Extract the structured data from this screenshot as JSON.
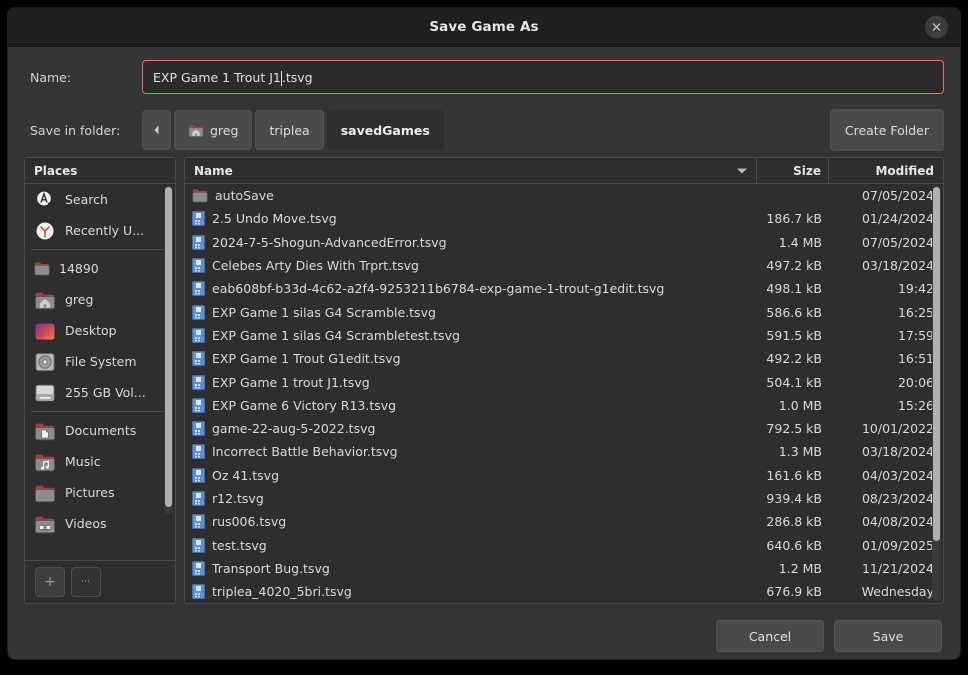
{
  "window": {
    "title": "Save Game As",
    "close_label": "✕"
  },
  "form": {
    "name_label": "Name:",
    "name_value_before_caret": "EXP Game 1 Trout J1",
    "name_value_after_caret": ".tsvg",
    "name_value_full": "EXP Game 1 Trout J1.tsvg",
    "name_placeholder": "",
    "folder_label": "Save in folder:",
    "create_folder_label": "Create Folder",
    "back_label": "◂"
  },
  "breadcrumbs": [
    {
      "label": "greg",
      "icon": "home-folder-icon",
      "current": false
    },
    {
      "label": "triplea",
      "icon": "",
      "current": false
    },
    {
      "label": "savedGames",
      "icon": "",
      "current": true
    }
  ],
  "places": {
    "header": "Places",
    "items": [
      {
        "label": "Search",
        "icon": "search-icon",
        "group": 0
      },
      {
        "label": "Recently U...",
        "icon": "clock-icon",
        "group": 0
      },
      {
        "label": "14890",
        "icon": "folder-icon",
        "group": 1
      },
      {
        "label": "greg",
        "icon": "home-folder-icon",
        "group": 1
      },
      {
        "label": "Desktop",
        "icon": "desktop-folder-icon",
        "group": 1
      },
      {
        "label": "File System",
        "icon": "disc-icon",
        "group": 1
      },
      {
        "label": "255 GB Vol...",
        "icon": "drive-icon",
        "group": 1
      },
      {
        "label": "Documents",
        "icon": "documents-folder-icon",
        "group": 2
      },
      {
        "label": "Music",
        "icon": "music-folder-icon",
        "group": 2
      },
      {
        "label": "Pictures",
        "icon": "pictures-folder-icon",
        "group": 2
      },
      {
        "label": "Videos",
        "icon": "videos-folder-icon",
        "group": 2
      }
    ],
    "add_button": "+",
    "more_button": "⋯"
  },
  "file_list": {
    "columns": {
      "name": "Name",
      "size": "Size",
      "modified": "Modified"
    },
    "sort_column": "Name",
    "sort_direction": "descending-arrow",
    "rows": [
      {
        "name": "autoSave",
        "size": "",
        "modified": "07/05/2024",
        "icon": "folder-icon"
      },
      {
        "name": "2.5 Undo Move.tsvg",
        "size": "186.7 kB",
        "modified": "01/24/2024",
        "icon": "file-icon"
      },
      {
        "name": "2024-7-5-Shogun-AdvancedError.tsvg",
        "size": "1.4 MB",
        "modified": "07/05/2024",
        "icon": "file-icon"
      },
      {
        "name": "Celebes Arty Dies With Trprt.tsvg",
        "size": "497.2 kB",
        "modified": "03/18/2024",
        "icon": "file-icon"
      },
      {
        "name": "eab608bf-b33d-4c62-a2f4-9253211b6784-exp-game-1-trout-g1edit.tsvg",
        "size": "498.1 kB",
        "modified": "19:42",
        "icon": "file-icon"
      },
      {
        "name": "EXP Game 1 silas G4 Scramble.tsvg",
        "size": "586.6 kB",
        "modified": "16:25",
        "icon": "file-icon"
      },
      {
        "name": "EXP Game 1 silas G4 Scrambletest.tsvg",
        "size": "591.5 kB",
        "modified": "17:59",
        "icon": "file-icon"
      },
      {
        "name": "EXP Game 1 Trout G1edit.tsvg",
        "size": "492.2 kB",
        "modified": "16:51",
        "icon": "file-icon"
      },
      {
        "name": "EXP Game 1 trout J1.tsvg",
        "size": "504.1 kB",
        "modified": "20:06",
        "icon": "file-icon"
      },
      {
        "name": "EXP Game 6 Victory R13.tsvg",
        "size": "1.0 MB",
        "modified": "15:26",
        "icon": "file-icon"
      },
      {
        "name": "game-22-aug-5-2022.tsvg",
        "size": "792.5 kB",
        "modified": "10/01/2022",
        "icon": "file-icon"
      },
      {
        "name": "Incorrect Battle Behavior.tsvg",
        "size": "1.3 MB",
        "modified": "03/18/2024",
        "icon": "file-icon"
      },
      {
        "name": "Oz 41.tsvg",
        "size": "161.6 kB",
        "modified": "04/03/2024",
        "icon": "file-icon"
      },
      {
        "name": "r12.tsvg",
        "size": "939.4 kB",
        "modified": "08/23/2024",
        "icon": "file-icon"
      },
      {
        "name": "rus006.tsvg",
        "size": "286.8 kB",
        "modified": "04/08/2024",
        "icon": "file-icon"
      },
      {
        "name": "test.tsvg",
        "size": "640.6 kB",
        "modified": "01/09/2025",
        "icon": "file-icon"
      },
      {
        "name": "Transport Bug.tsvg",
        "size": "1.2 MB",
        "modified": "11/21/2024",
        "icon": "file-icon"
      },
      {
        "name": "triplea_4020_5bri.tsvg",
        "size": "676.9 kB",
        "modified": "Wednesday",
        "icon": "file-icon"
      }
    ]
  },
  "footer": {
    "cancel_label": "Cancel",
    "save_label": "Save"
  },
  "colors": {
    "accent_border": "#d9795f",
    "window_bg": "#353535",
    "titlebar_bg": "#1f1f1f",
    "pane_bg": "#2e2e2e",
    "file_icon": "#5b8fd6",
    "folder_tab": "#b03a3a"
  }
}
